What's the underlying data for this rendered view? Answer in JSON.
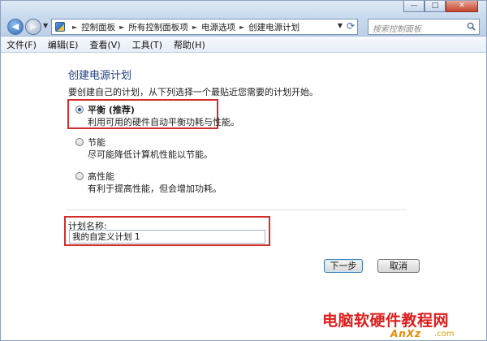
{
  "window": {
    "minimize_icon": "minimize-icon",
    "maximize_icon": "maximize-icon",
    "close_icon": "close-icon"
  },
  "address_bar": {
    "breadcrumbs": [
      "控制面板",
      "所有控制面板项",
      "电源选项",
      "创建电源计划"
    ]
  },
  "search": {
    "placeholder": "搜索控制面板"
  },
  "menu": {
    "items": [
      "文件(F)",
      "编辑(E)",
      "查看(V)",
      "工具(T)",
      "帮助(H)"
    ]
  },
  "page": {
    "title": "创建电源计划",
    "intro": "要创建自己的计划，从下列选择一个最贴近您需要的计划开始。"
  },
  "plans": [
    {
      "label": "平衡 (推荐)",
      "description": "利用可用的硬件自动平衡功耗与性能。",
      "selected": true
    },
    {
      "label": "节能",
      "description": "尽可能降低计算机性能以节能。",
      "selected": false
    },
    {
      "label": "高性能",
      "description": "有利于提高性能，但会增加功耗。",
      "selected": false
    }
  ],
  "plan_name": {
    "label": "计划名称:",
    "value": "我的自定义计划 1"
  },
  "buttons": {
    "next": "下一步",
    "cancel": "取消"
  },
  "watermark": {
    "text": "电脑软硬件教程网",
    "logo": "AnXz",
    "url": ".com"
  },
  "colors": {
    "title": "#1e3f86",
    "highlight": "#d42b2b",
    "watermark": "#e01c1c"
  }
}
